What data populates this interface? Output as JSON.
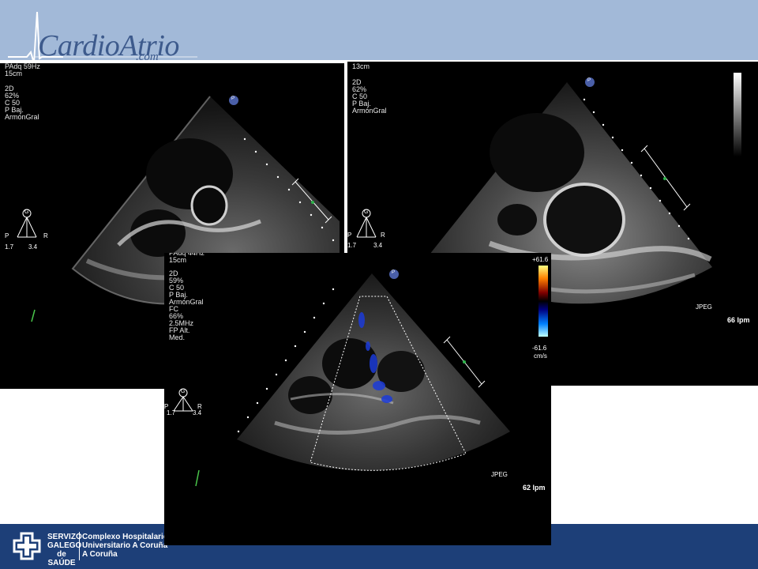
{
  "header": {
    "logo_main": "CardioAtrio",
    "logo_domain": ".com",
    "logo_icon": "heartbeat-line-icon"
  },
  "footer": {
    "org_lines": "SERVIZO\nGALEGO\nde SAÚDE",
    "hospital_lines": "Complexo Hospitalario\nUniversitario A Coruña\nA Coruña",
    "org_icon": "sergas-cross-icon"
  },
  "panels": {
    "left": {
      "top_text": "PAdq 59Hz\n15cm",
      "params": "2D\n 62%\nC 50\nP Baj.\nArmónGral",
      "probe_label": "P",
      "orient_g": "G",
      "orient_p": "P",
      "orient_r": "R",
      "scale_a": "1.7",
      "scale_b": "3.4"
    },
    "right": {
      "top_text": "13cm",
      "params": "2D\n 62%\nC 50\nP Baj.\nArmónGral",
      "probe_label": "P",
      "orient_g": "G",
      "orient_p": "P",
      "orient_r": "R",
      "scale_a": "1.7",
      "scale_b": "3.4",
      "jpeg": "JPEG",
      "hr": "66 lpm"
    },
    "center": {
      "top_text": "PAdq 44Hz\n15cm",
      "params": "2D\n 59%\nC 50\nP Baj.\nArmónGral\nFC\n 66%\n2.5MHz\nFP Alt.\nMed.",
      "probe_label": "P",
      "orient_g": "G",
      "orient_p": "P",
      "orient_r": "R",
      "scale_a": "1.7",
      "scale_b": "3.4",
      "jpeg": "JPEG",
      "hr": "62 lpm",
      "color_max": "+61.6",
      "color_min": "-61.6",
      "color_unit": "cm/s"
    }
  },
  "colors": {
    "header_band": "#a2b9d8",
    "footer_band": "#1d3f78",
    "logo_blue": "#3d5a8c"
  }
}
